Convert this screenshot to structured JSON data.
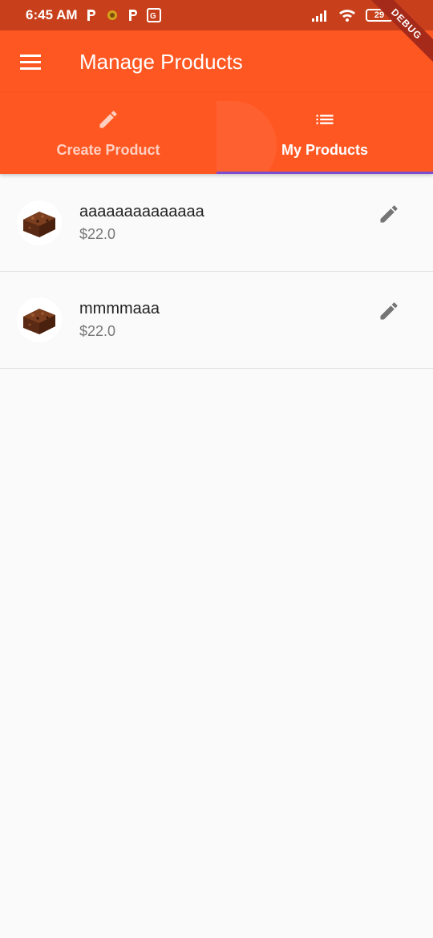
{
  "status_bar": {
    "time": "6:45 AM",
    "battery": "29"
  },
  "debug_banner": "DEBUG",
  "app_bar": {
    "title": "Manage Products"
  },
  "tabs": [
    {
      "label": "Create Product",
      "icon": "pencil-icon",
      "active": false
    },
    {
      "label": "My Products",
      "icon": "list-icon",
      "active": true
    }
  ],
  "products": [
    {
      "name": "aaaaaaaaaaaaaa",
      "price": "$22.0",
      "image": "brownie-image"
    },
    {
      "name": "mmmmaaa",
      "price": "$22.0",
      "image": "brownie-image"
    }
  ],
  "colors": {
    "primary": "#ff5722",
    "status_bar": "#c8401b",
    "tab_indicator": "#7c4dce",
    "background": "#fafafa"
  }
}
